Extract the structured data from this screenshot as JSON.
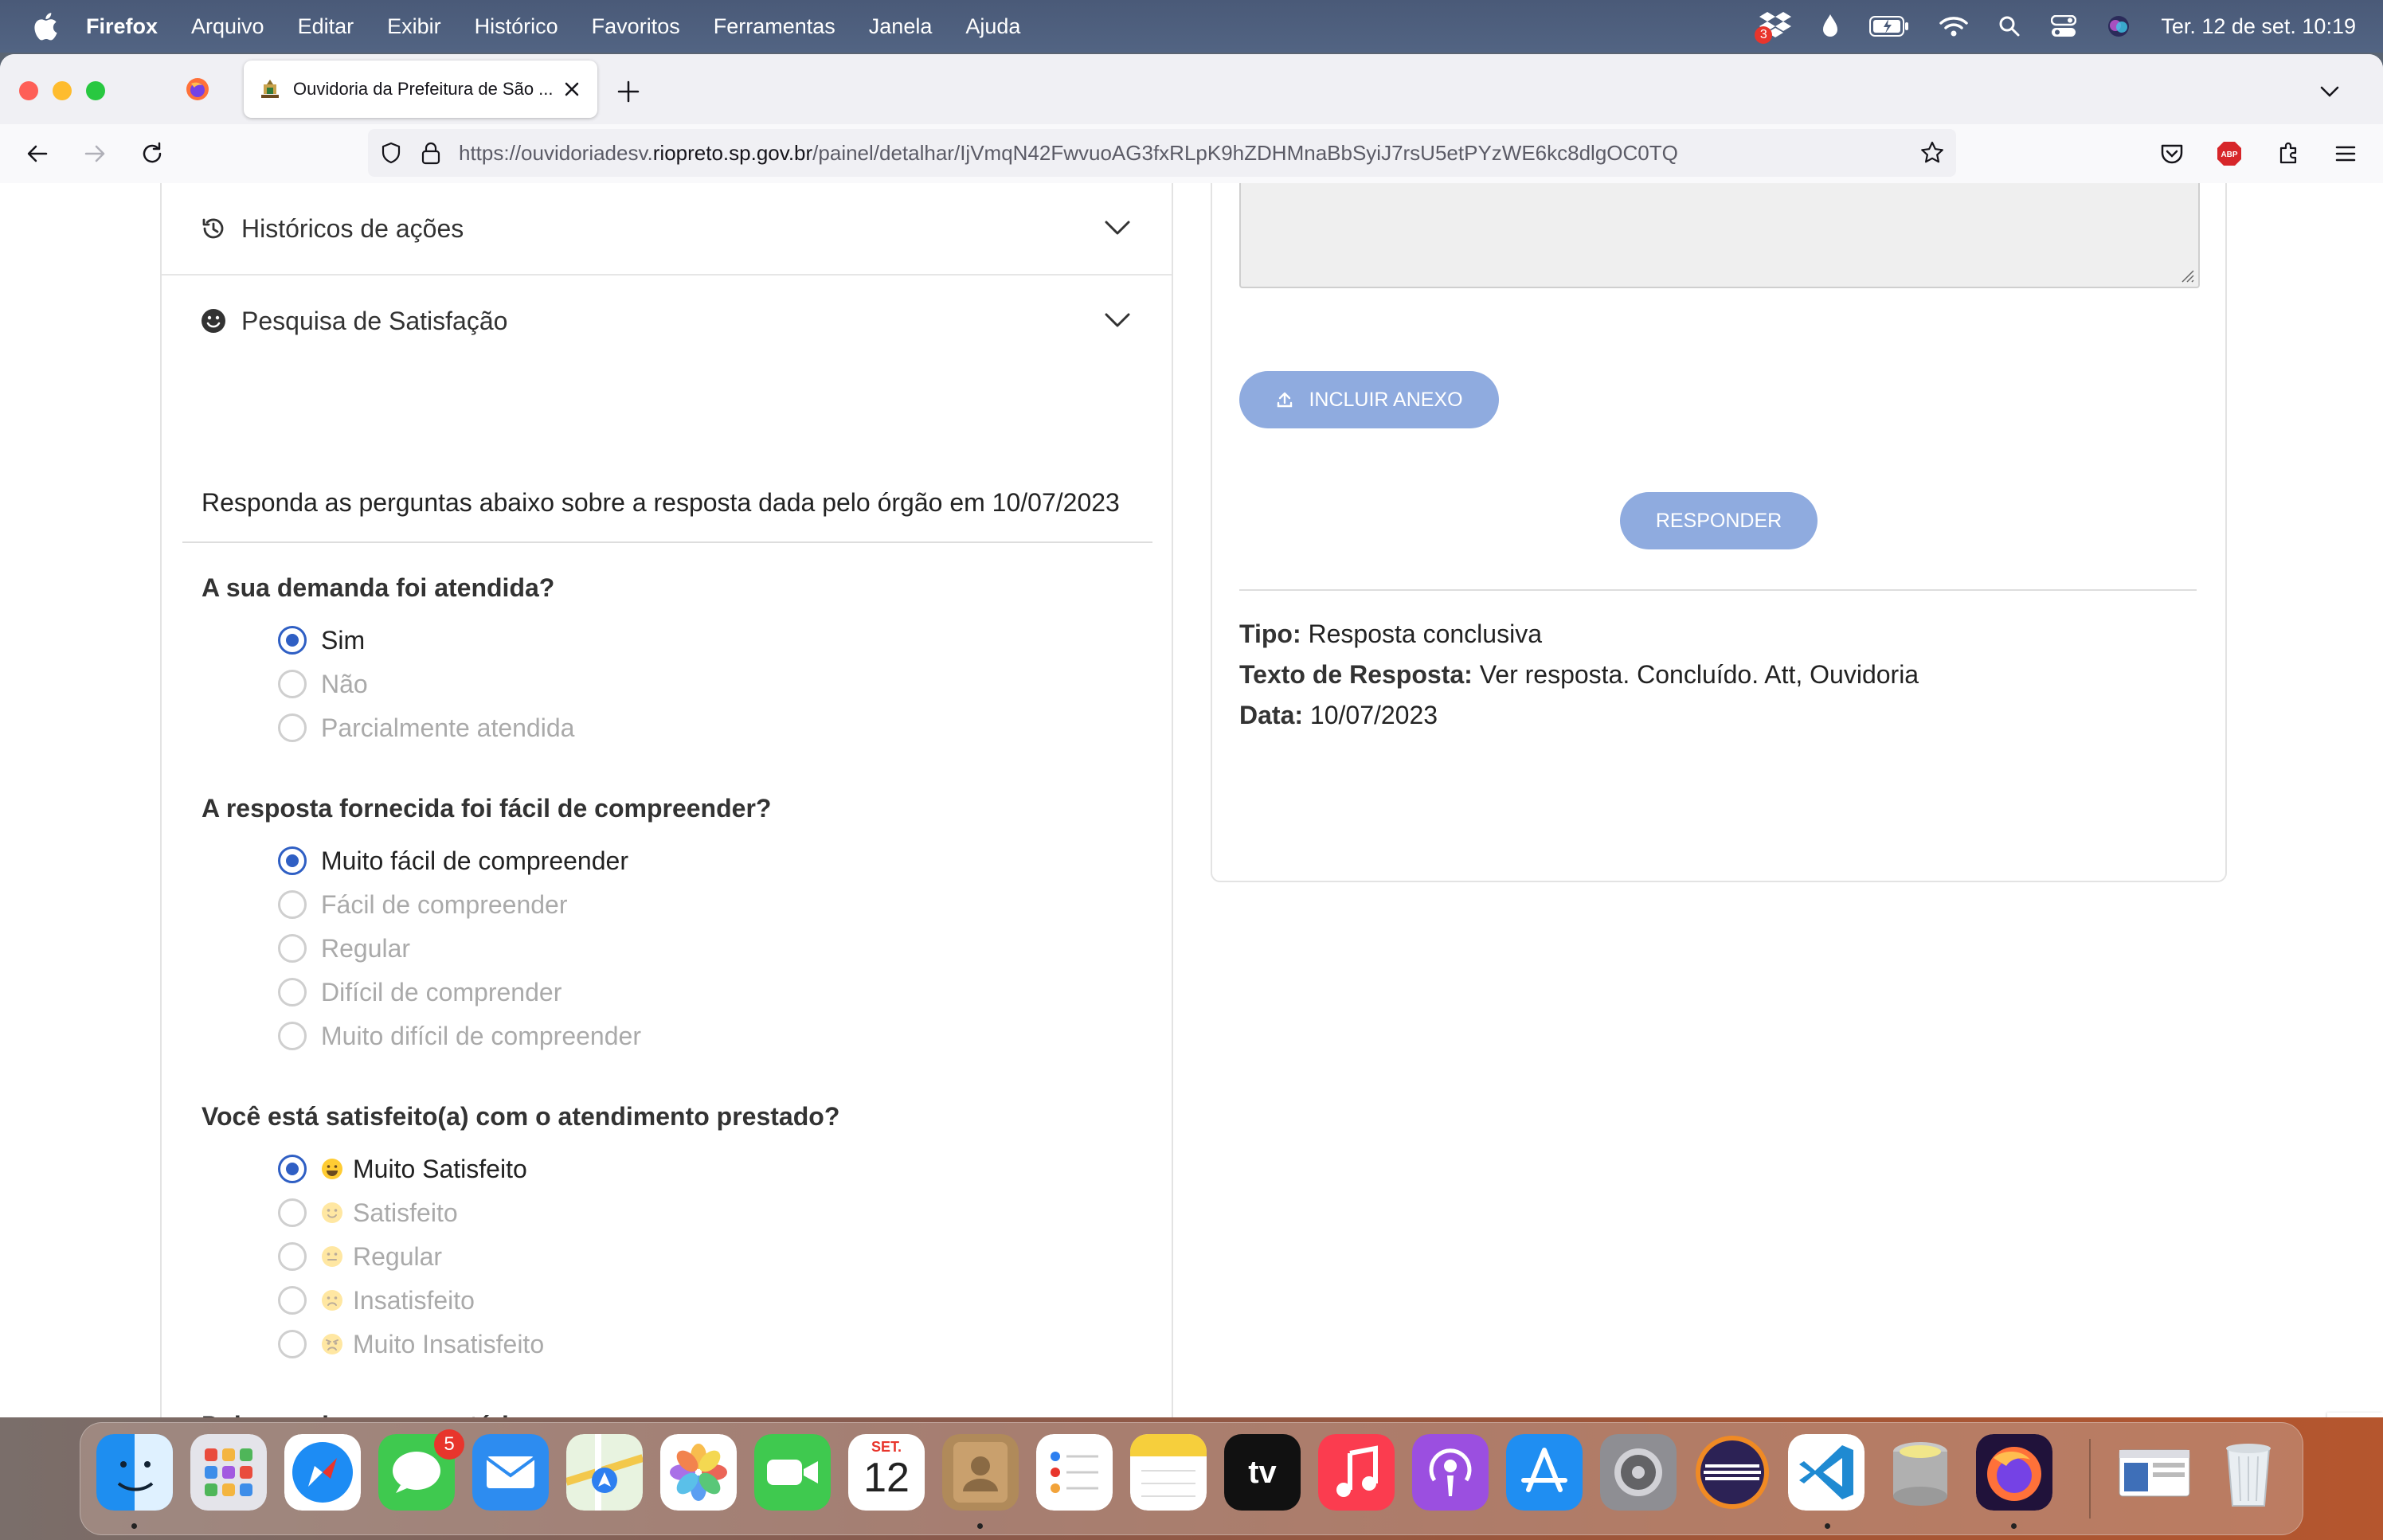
{
  "menubar": {
    "app": "Firefox",
    "items": [
      "Arquivo",
      "Editar",
      "Exibir",
      "Histórico",
      "Favoritos",
      "Ferramentas",
      "Janela",
      "Ajuda"
    ],
    "clock": "Ter. 12 de set.  10:19",
    "dropbox_badge": "3"
  },
  "browser": {
    "tab_title": "Ouvidoria da Prefeitura de São ...",
    "url_prefix": "https://ouvidoriadesv.",
    "url_domain": "riopreto.sp.gov.br",
    "url_path": "/painel/detalhar/IjVmqN42FwvuoAG3fxRLpK9hZDHMnaBbSyiJ7rsU5etPYzWE6kc8dlgOC0TQ"
  },
  "left": {
    "acc_history": "Históricos de ações",
    "acc_survey": "Pesquisa de Satisfação",
    "intro": "Responda as perguntas abaixo sobre a resposta dada pelo órgão em 10/07/2023",
    "q1": {
      "title": "A sua demanda foi atendida?",
      "options": [
        "Sim",
        "Não",
        "Parcialmente atendida"
      ],
      "selected": 0
    },
    "q2": {
      "title": "A resposta fornecida foi fácil de compreender?",
      "options": [
        "Muito fácil de compreender",
        "Fácil de compreender",
        "Regular",
        "Difícil de comprender",
        "Muito difícil de compreender"
      ],
      "selected": 0
    },
    "q3": {
      "title": "Você está satisfeito(a) com o atendimento prestado?",
      "options": [
        "Muito Satisfeito",
        "Satisfeito",
        "Regular",
        "Insatisfeito",
        "Muito Insatisfeito"
      ],
      "selected": 0
    },
    "comment_label": "Deixe aqui seu comentário:"
  },
  "right": {
    "attach_label": "INCLUIR ANEXO",
    "reply_label": "RESPONDER",
    "tipo_label": "Tipo:",
    "tipo_value": "Resposta conclusiva",
    "texto_label": "Texto de Resposta:",
    "texto_value": "Ver resposta. Concluído. Att, Ouvidoria",
    "data_label": "Data:",
    "data_value": "10/07/2023"
  },
  "dock": {
    "messages_badge": "5",
    "calendar_month": "SET.",
    "calendar_day": "12",
    "tv_label": "tv"
  }
}
